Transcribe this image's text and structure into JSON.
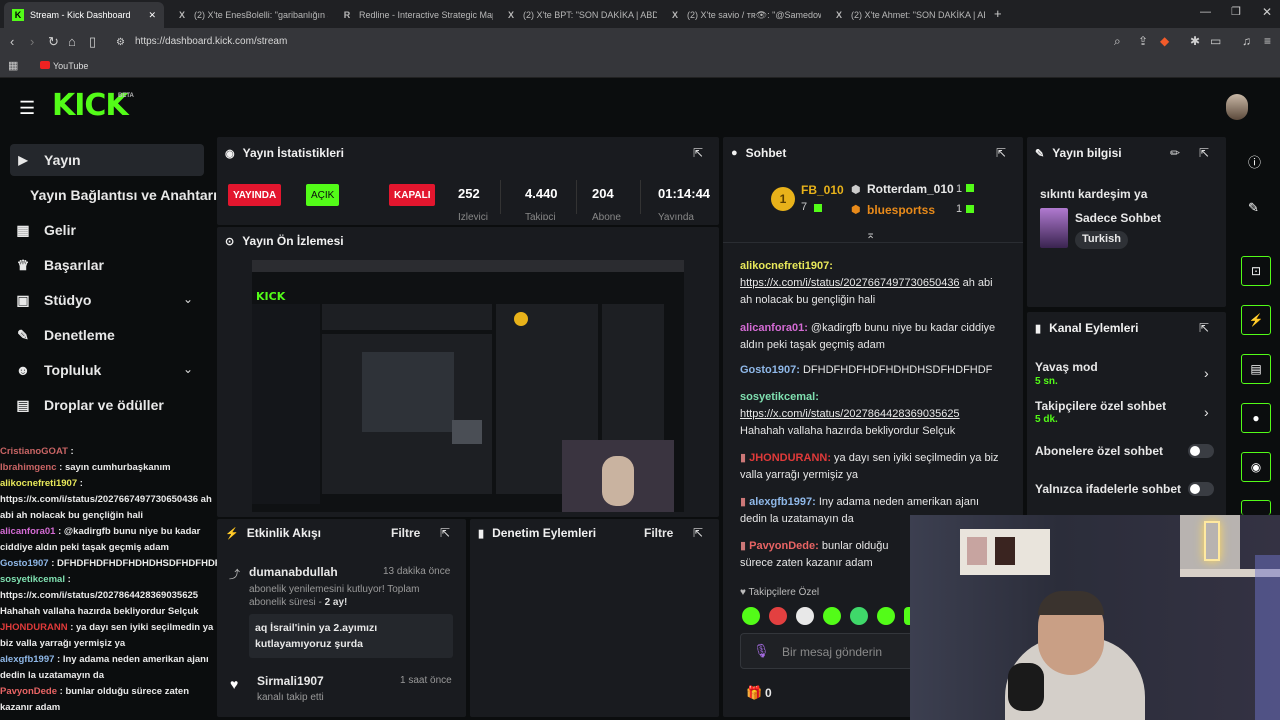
{
  "browser": {
    "tabs": [
      {
        "label": "Stream - Kick Dashboard",
        "icon": "K"
      },
      {
        "label": "(2) X'te EnesBolelli: \"garibanlığın ana",
        "icon": "X"
      },
      {
        "label": "Redline - Interactive Strategic Map",
        "icon": "R"
      },
      {
        "label": "(2) X'te BPT: \"SON DAKİKA | ABD Baş",
        "icon": "X"
      },
      {
        "label": "(2) X'te savio / ᴛʀ👁: \"@Samedowski",
        "icon": "X"
      },
      {
        "label": "(2) X'te Ahmet: \"SON DAKİKA | ABD B",
        "icon": "X"
      }
    ],
    "new_tab": "+",
    "url": "https://dashboard.kick.com/stream",
    "bookmark": "YouTube"
  },
  "kick": {
    "logo": "KICK",
    "beta": "BETA"
  },
  "sidebar": {
    "items": [
      {
        "label": "Yayın",
        "icon": "🎥"
      },
      {
        "label": "Yayın Bağlantısı ve Anahtarı",
        "icon": ""
      },
      {
        "label": "Gelir",
        "icon": "▦"
      },
      {
        "label": "Başarılar",
        "icon": "🏆"
      },
      {
        "label": "Stüdyo",
        "icon": "▣"
      },
      {
        "label": "Denetleme",
        "icon": "🔧"
      },
      {
        "label": "Topluluk",
        "icon": "👥"
      },
      {
        "label": "Droplar ve ödüller",
        "icon": "▤"
      }
    ],
    "chat_lines": [
      {
        "user": "CristianoGOAT",
        "text": " :",
        "color": "#c86464"
      },
      {
        "user": "Ibrahimgenc",
        "text": " : sayın cumhurbaşkanım",
        "color": "#c86464"
      },
      {
        "user": "alikocnefreti1907",
        "text": " :",
        "color": "#e8e85a"
      },
      {
        "user": "",
        "text": "https://x.com/i/status/2027667497730650436 ah",
        "color": "#fff"
      },
      {
        "user": "",
        "text": "abi ah nolacak bu gençliğin hali",
        "color": "#fff"
      },
      {
        "user": "alicanfora01",
        "text": " : @kadirgfb bunu niye bu kadar",
        "color": "#d46bd4"
      },
      {
        "user": "",
        "text": "ciddiye aldın peki taşak geçmiş adam",
        "color": "#fff"
      },
      {
        "user": "Gosto1907",
        "text": " : DFHDFHDFHDFHDHDHSDFHDFHDF",
        "color": "#8fb8e8"
      },
      {
        "user": "sosyetikcemal",
        "text": " :",
        "color": "#7fe0b0"
      },
      {
        "user": "",
        "text": "https://x.com/i/status/2027864428369035625",
        "color": "#fff"
      },
      {
        "user": "",
        "text": "Hahahah vallaha hazırda bekliyordur Selçuk",
        "color": "#fff"
      },
      {
        "user": "JHONDURANN",
        "text": " : ya dayı sen iyiki seçilmedin ya",
        "color": "#e03a3a"
      },
      {
        "user": "",
        "text": "biz valla yarrağı yermişiz ya",
        "color": "#fff"
      },
      {
        "user": "alexgfb1997",
        "text": " : Iny adama neden amerikan ajanı",
        "color": "#8fb8e8"
      },
      {
        "user": "",
        "text": "dedin la uzatamayın da",
        "color": "#fff"
      },
      {
        "user": "PavyonDede",
        "text": " : bunlar olduğu sürece zaten",
        "color": "#e86464"
      },
      {
        "user": "",
        "text": "kazanır adam",
        "color": "#fff"
      }
    ]
  },
  "stats": {
    "title": "Yayın İstatistikleri",
    "live": "YAYINDA",
    "open": "AÇIK",
    "closed": "KAPALI",
    "viewers": "252",
    "viewers_label": "İzleyici",
    "followers": "4.440",
    "followers_label": "Takipçi",
    "subs": "204",
    "subs_label": "Abone",
    "duration": "01:14:44",
    "duration_label": "Yayında"
  },
  "preview": {
    "title": "Yayın Ön İzlemesi"
  },
  "activity": {
    "title": "Etkinlik Akışı",
    "filter": "Filtre",
    "events": [
      {
        "user": "dumanabdullah",
        "time": "13 dakika önce",
        "desc": "abonelik yenilemesini kutluyor! Toplam abonelik süresi - ",
        "months": "2 ay!",
        "message": "aq İsrail'inin ya 2.ayımızı kutlayamıyoruz şurda"
      },
      {
        "user": "Sirmali1907",
        "time": "1 saat önce",
        "desc": "kanalı takip etti"
      }
    ]
  },
  "moderation": {
    "title": "Denetim Eylemleri",
    "filter": "Filtre"
  },
  "chat": {
    "title": "Sohbet",
    "leaders": [
      {
        "name": "FB_010",
        "count": "7"
      },
      {
        "name": "Rotterdam_010",
        "count": "1"
      },
      {
        "name": "bluesportss",
        "count": "1"
      }
    ],
    "rank_number": "1",
    "messages": [
      {
        "user": "alikocnefreti1907:",
        "color": "#e8e85a",
        "link": "https://x.com/i/status/2027667497730650436",
        "text": " ah abi ah nolacak bu gençliğin hali"
      },
      {
        "user": "alicanfora01:",
        "color": "#d46bd4",
        "text": " @kadirgfb bunu niye bu kadar ciddiye aldın peki taşak geçmiş adam"
      },
      {
        "user": "Gosto1907:",
        "color": "#8fb8e8",
        "text": " DFHDFHDFHDFHDHDHSDFHDFHDF"
      },
      {
        "user": "sosyetikcemal:",
        "color": "#7fe0b0",
        "link": "https://x.com/i/status/2027864428369035625",
        "text": "Hahahah vallaha hazırda bekliyordur Selçuk"
      },
      {
        "user": "JHONDURANN:",
        "color": "#e03a3a",
        "text": " ya dayı sen iyiki seçilmedin ya biz valla yarrağı yermişiz ya"
      },
      {
        "user": "alexgfb1997:",
        "color": "#8fb8e8",
        "text": " Iny adama neden amerikan ajanı dedin la uzatamayın da"
      },
      {
        "user": "PavyonDede:",
        "color": "#e86464",
        "text": " bunlar olduğu sürece zaten kazanır adam"
      }
    ],
    "followers_only": "Takipçilere Özel",
    "placeholder": "Bir mesaj gönderin",
    "points": "0"
  },
  "stream_info": {
    "title": "Yayın bilgisi",
    "stream_title": "sıkıntı kardeşim ya",
    "category": "Sadece Sohbet",
    "language": "Turkish"
  },
  "channel_actions": {
    "title": "Kanal Eylemleri",
    "slow_mode": "Yavaş mod",
    "slow_mode_value": "5 sn.",
    "followers_chat": "Takipçilere özel sohbet",
    "followers_chat_value": "5 dk.",
    "subscribers_chat": "Abonelere özel sohbet",
    "emotes_only": "Yalnızca ifadelerle sohbet"
  },
  "colors": {
    "brand": "#53fc18",
    "live": "#e3162e",
    "panel": "#191b1f"
  }
}
